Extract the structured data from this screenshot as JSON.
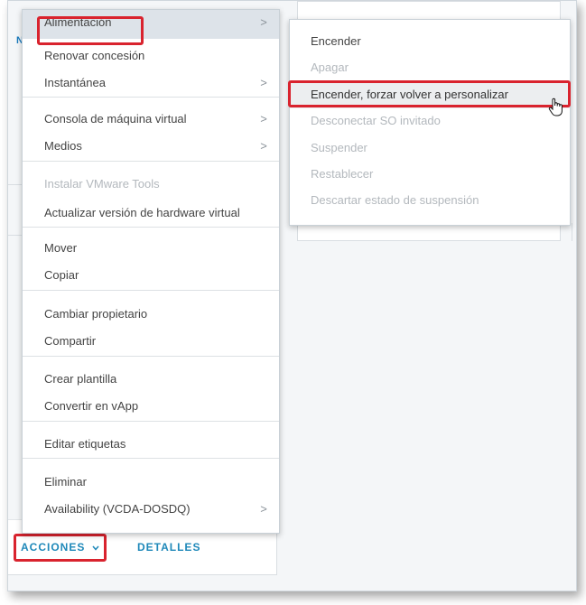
{
  "background": {
    "partial_letter": "N",
    "footer": {
      "actions_label": "ACCIONES",
      "actions_chevron": "chevron-down-icon",
      "details_label": "DETALLES"
    }
  },
  "menu": {
    "items": [
      {
        "label": "Alimentación",
        "submenu": true,
        "disabled": false,
        "active": true
      },
      {
        "label": "Renovar concesión",
        "submenu": false,
        "disabled": false
      },
      {
        "label": "Instantánea",
        "submenu": true,
        "disabled": false
      },
      {
        "label": "Consola de máquina virtual",
        "submenu": true,
        "disabled": false
      },
      {
        "label": "Medios",
        "submenu": true,
        "disabled": false
      },
      {
        "label": "Instalar VMware Tools",
        "submenu": false,
        "disabled": true
      },
      {
        "label": "Actualizar versión de hardware virtual",
        "submenu": false,
        "disabled": false
      },
      {
        "label": "Mover",
        "submenu": false,
        "disabled": false
      },
      {
        "label": "Copiar",
        "submenu": false,
        "disabled": false
      },
      {
        "label": "Cambiar propietario",
        "submenu": false,
        "disabled": false
      },
      {
        "label": "Compartir",
        "submenu": false,
        "disabled": false
      },
      {
        "label": "Crear plantilla",
        "submenu": false,
        "disabled": false
      },
      {
        "label": "Convertir en vApp",
        "submenu": false,
        "disabled": false
      },
      {
        "label": "Editar etiquetas",
        "submenu": false,
        "disabled": false
      },
      {
        "label": "Eliminar",
        "submenu": false,
        "disabled": false
      },
      {
        "label": "Availability (VCDA-DOSDQ)",
        "submenu": true,
        "disabled": false
      }
    ],
    "chevron_glyph": ">"
  },
  "submenu": {
    "items": [
      {
        "label": "Encender",
        "disabled": false
      },
      {
        "label": "Apagar",
        "disabled": true
      },
      {
        "label": "Encender, forzar volver a personalizar",
        "disabled": false,
        "hover": true
      },
      {
        "label": "Desconectar SO invitado",
        "disabled": true
      },
      {
        "label": "Suspender",
        "disabled": true
      },
      {
        "label": "Restablecer",
        "disabled": true
      },
      {
        "label": "Descartar estado de suspensión",
        "disabled": true
      }
    ]
  },
  "colors": {
    "highlight": "#d9232e",
    "link": "#1e88b9",
    "active_item_bg": "#dde3e9",
    "disabled_text": "#b3b8bd"
  }
}
